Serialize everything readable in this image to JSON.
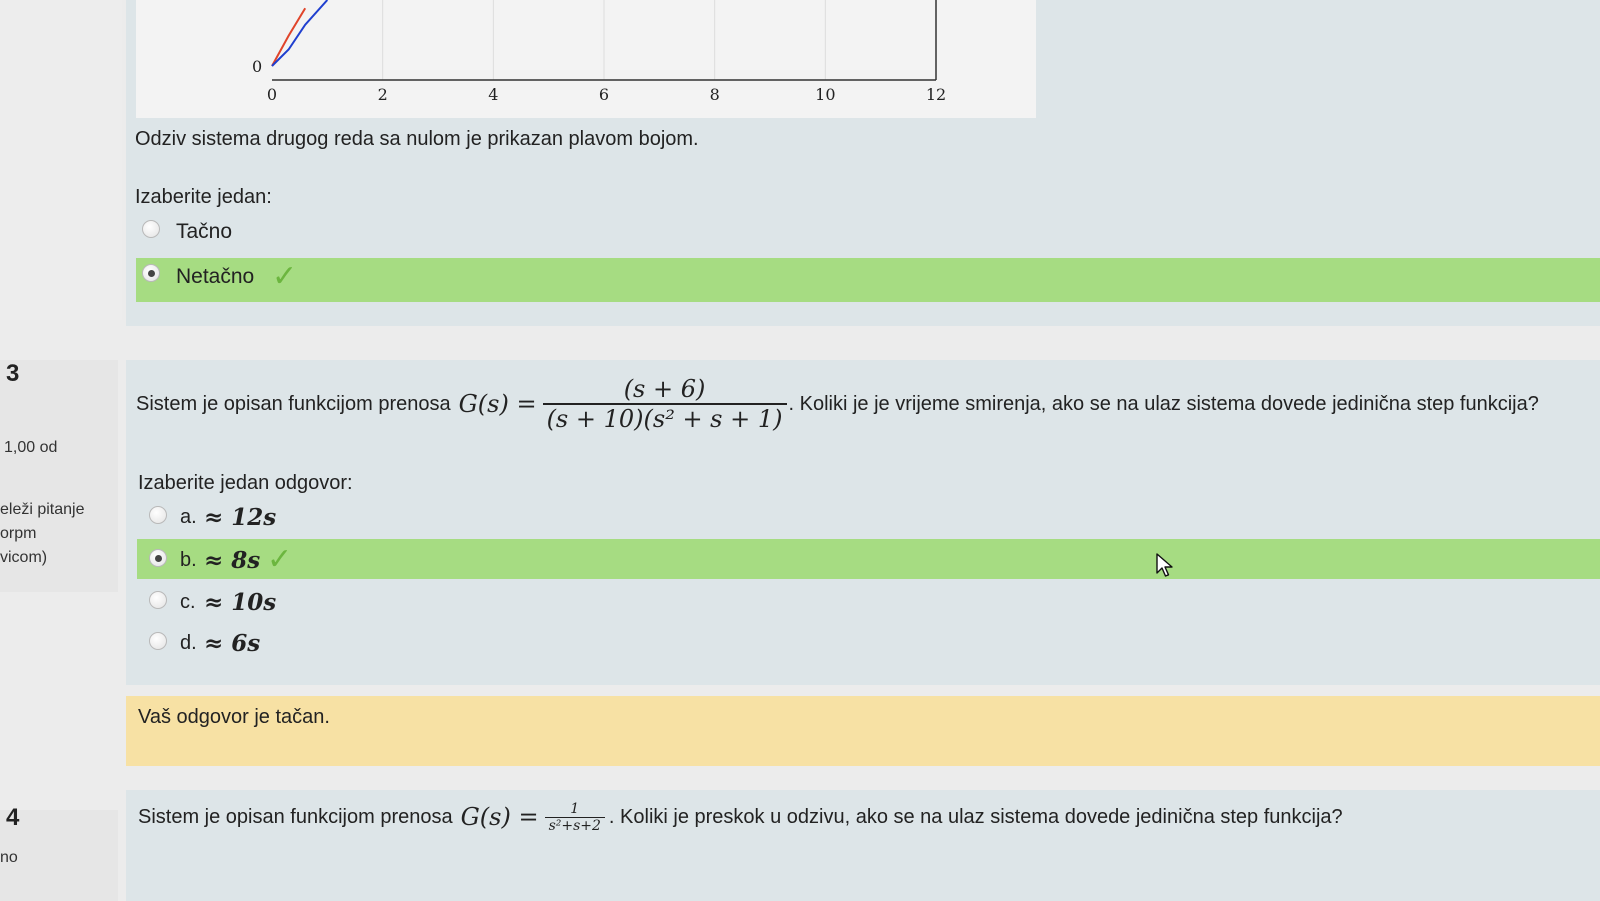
{
  "chart_data": {
    "type": "line",
    "x_ticks": [
      "0",
      "2",
      "4",
      "6",
      "8",
      "10",
      "12"
    ],
    "y_ticks": [
      "0"
    ],
    "xlim": [
      0,
      12
    ],
    "series": [
      {
        "color": "#e0442a",
        "x": [
          0,
          0.3,
          0.6
        ],
        "y": [
          0,
          0.55,
          1.05
        ]
      },
      {
        "color": "#1f3fcf",
        "x": [
          0,
          0.3,
          0.6,
          1.0
        ],
        "y": [
          0,
          0.3,
          0.75,
          1.2
        ]
      }
    ]
  },
  "q2": {
    "statement": "Odziv sistema drugog reda sa nulom je prikazan plavom bojom.",
    "prompt": "Izaberite jedan:",
    "options": [
      {
        "label": "Tačno",
        "selected": false
      },
      {
        "label": "Netačno",
        "selected": true,
        "correct": true
      }
    ]
  },
  "q3": {
    "number": "3",
    "score": "1,00 od",
    "flag_lines": [
      "eleži pitanje",
      "orpm",
      "vicom)"
    ],
    "statement_prefix": "Sistem je opisan funkcijom prenosa",
    "formula_lhs": "G(s) =",
    "formula_num": "(s + 6)",
    "formula_den": "(s + 10)(s² + s + 1)",
    "statement_suffix": ". Koliki je je vrijeme smirenja, ako se na ulaz sistema dovede jedinična step funkcija?",
    "prompt": "Izaberite jedan odgovor:",
    "options": [
      {
        "letter": "a.",
        "value": "≈ 12s",
        "selected": false
      },
      {
        "letter": "b.",
        "value": "≈ 8s",
        "selected": true,
        "correct": true
      },
      {
        "letter": "c.",
        "value": "≈ 10s",
        "selected": false
      },
      {
        "letter": "d.",
        "value": "≈ 6s",
        "selected": false
      }
    ],
    "feedback": "Vaš odgovor je tačan."
  },
  "q4": {
    "number": "4",
    "info": "no",
    "statement_prefix": "Sistem je opisan funkcijom prenosa",
    "formula_lhs": "G(s) =",
    "formula_num": "1",
    "formula_den": "s²+s+2",
    "statement_suffix": ". Koliki je preskok u odzivu, ako se na ulaz sistema dovede jedinična step funkcija?"
  },
  "colors": {
    "panel": "#dde5e8",
    "correct_row": "#a6dc82",
    "checkmark": "#6cb63f",
    "feedback_bg": "#f7e1a4"
  }
}
